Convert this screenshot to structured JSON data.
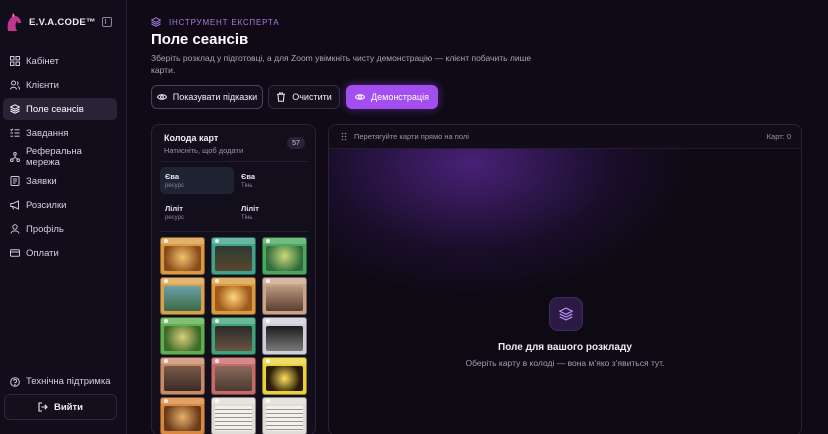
{
  "brand": {
    "name": "E.V.A.CODE™"
  },
  "sidebar": {
    "items": [
      {
        "label": "Кабінет",
        "icon": "grid-icon",
        "active": false
      },
      {
        "label": "Клієнти",
        "icon": "users-icon",
        "active": false
      },
      {
        "label": "Поле сеансів",
        "icon": "layers-icon",
        "active": true
      },
      {
        "label": "Завдання",
        "icon": "tasks-icon",
        "active": false
      },
      {
        "label": "Реферальна мережа",
        "icon": "network-icon",
        "active": false
      },
      {
        "label": "Заявки",
        "icon": "inbox-icon",
        "active": false
      },
      {
        "label": "Розсилки",
        "icon": "megaphone-icon",
        "active": false
      },
      {
        "label": "Профіль",
        "icon": "user-icon",
        "active": false
      },
      {
        "label": "Оплати",
        "icon": "card-icon",
        "active": false
      }
    ],
    "support_label": "Технічна підтримка",
    "logout_label": "Вийти"
  },
  "header": {
    "eyebrow": "ІНСТРУМЕНТ ЕКСПЕРТА",
    "title": "Поле сеансів",
    "subtitle": "Зберіть розклад у підготовці, а для Zoom увімкніть чисту демонстрацію — клієнт побачить лише карти."
  },
  "toolbar": {
    "hints_label": "Показувати підказки",
    "clear_label": "Очистити",
    "demo_label": "Демонстрація"
  },
  "deck": {
    "title": "Колода карт",
    "subtitle": "Натисніть, щоб додати",
    "count": "57",
    "chips": [
      {
        "name": "Єва",
        "type": "ресурс",
        "selected": true
      },
      {
        "name": "Єва",
        "type": "Тінь",
        "selected": false
      },
      {
        "name": "Ліліт",
        "type": "ресурс",
        "selected": false
      },
      {
        "name": "Ліліт",
        "type": "Тінь",
        "selected": false
      }
    ]
  },
  "field": {
    "hint": "Перетягуйте карти прямо на полі",
    "count_label": "Карт: 0",
    "empty_title": "Поле для вашого розкладу",
    "empty_subtitle": "Оберіть карту в колоді — вона м’яко з’явиться тут."
  },
  "colors": {
    "accent": "#a24ef0",
    "eyebrow": "#a77be3",
    "background": "#0f0a16"
  }
}
